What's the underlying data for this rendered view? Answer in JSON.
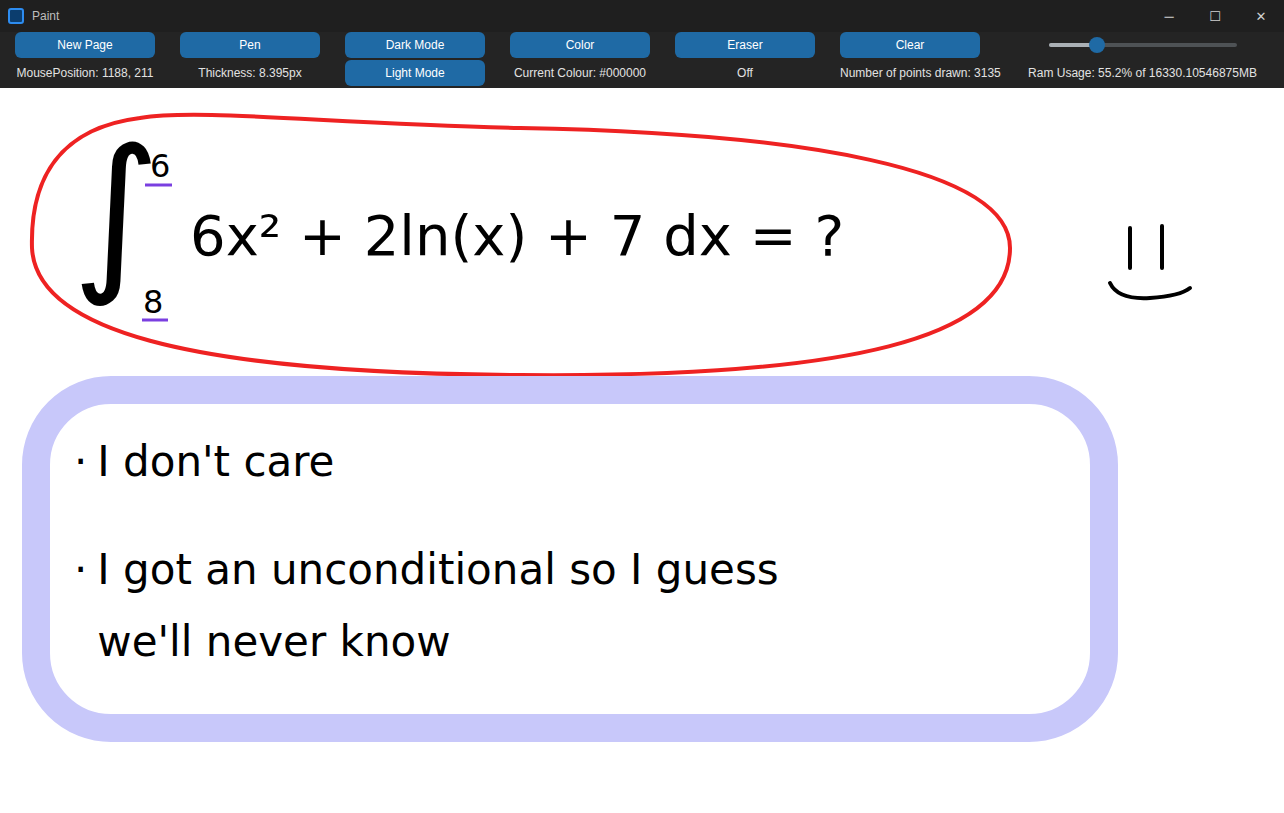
{
  "window": {
    "title": "Paint",
    "controls": [
      "─",
      "☐",
      "✕"
    ]
  },
  "toolbar": {
    "buttons": [
      {
        "label": "New Page",
        "status": "MousePosition: 1188, 211"
      },
      {
        "label": "Pen",
        "status": "Thickness: 8.395px"
      },
      {
        "label": "Dark Mode",
        "status": "Light Mode",
        "status_kind": "button"
      },
      {
        "label": "Color",
        "status": "Current Colour: #000000"
      },
      {
        "label": "Eraser",
        "status": "Off"
      },
      {
        "label": "Clear",
        "status": "Number of points drawn: 3135"
      }
    ],
    "slider": {
      "level": 0.26
    },
    "ram": "Ram Usage: 55.2% of 16330.10546875MB"
  },
  "canvas": {
    "integral": "∫",
    "upper": "6",
    "lower": "8",
    "expression": "6x² + 2ln(x) + 7 dx = ?",
    "notes": [
      {
        "bullet": "·",
        "lines": [
          "I don't care"
        ]
      },
      {
        "bullet": "·",
        "lines": [
          "I got an unconditional so I guess",
          "we'll never know"
        ]
      }
    ]
  }
}
